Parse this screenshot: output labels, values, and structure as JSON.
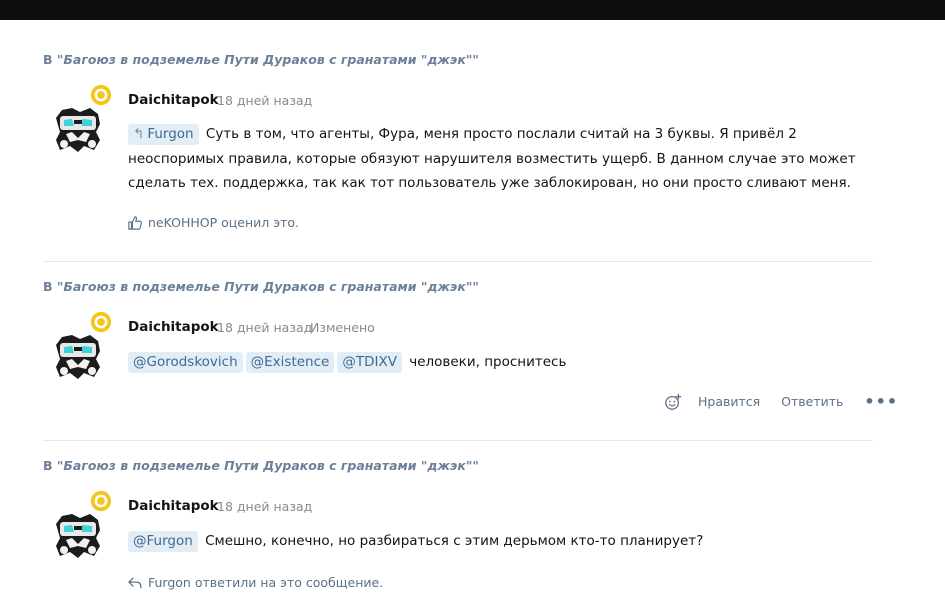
{
  "colors": {
    "topbar": "#0d0d0d",
    "thread_link": "#6b8199",
    "tag_bg": "#e3edf6",
    "tag_text": "#3f6a92",
    "badge": "#f5c518",
    "muted": "#8a8a8a"
  },
  "posts": [
    {
      "thread_prefix": "В ",
      "thread_name": "\"Багоюз в подземелье Пути Дураков с гранатами \"джэк\"\"",
      "author": "Daichitapok",
      "time": "18 дней назад",
      "quote_tag": "Furgon",
      "text": "Суть в том, что агенты, Фура, меня просто послали считай на 3 буквы. Я привёл 2 неоспоримых правила, которые обязуют нарушителя возместить ущерб. В данном случае это может сделать тех. поддержка, так как тот пользователь уже заблокирован, но они просто сливают меня.",
      "reaction_note": "neKOHHOP оценил это.",
      "footnote_icon": "thumbs-up-icon"
    },
    {
      "thread_prefix": "В ",
      "thread_name": "\"Багоюз в подземелье Пути Дураков с гранатами \"джэк\"\"",
      "author": "Daichitapok",
      "time": "18 дней назад",
      "edited": "Изменено",
      "mentions": [
        "@Gorodskovich",
        "@Existence",
        "@TDIXV"
      ],
      "text": "человеки, проснитесь",
      "actions": {
        "like": "Нравится",
        "reply": "Ответить",
        "more": "•••"
      }
    },
    {
      "thread_prefix": "В ",
      "thread_name": "\"Багоюз в подземелье Пути Дураков с гранатами \"джэк\"\"",
      "author": "Daichitapok",
      "time": "18 дней назад",
      "mention": "@Furgon",
      "text": "Смешно, конечно, но разбираться с этим дерьмом кто-то планирует?",
      "reply_note": "Furgon ответили на это сообщение.",
      "footnote_icon": "reply-arrow-icon"
    }
  ]
}
